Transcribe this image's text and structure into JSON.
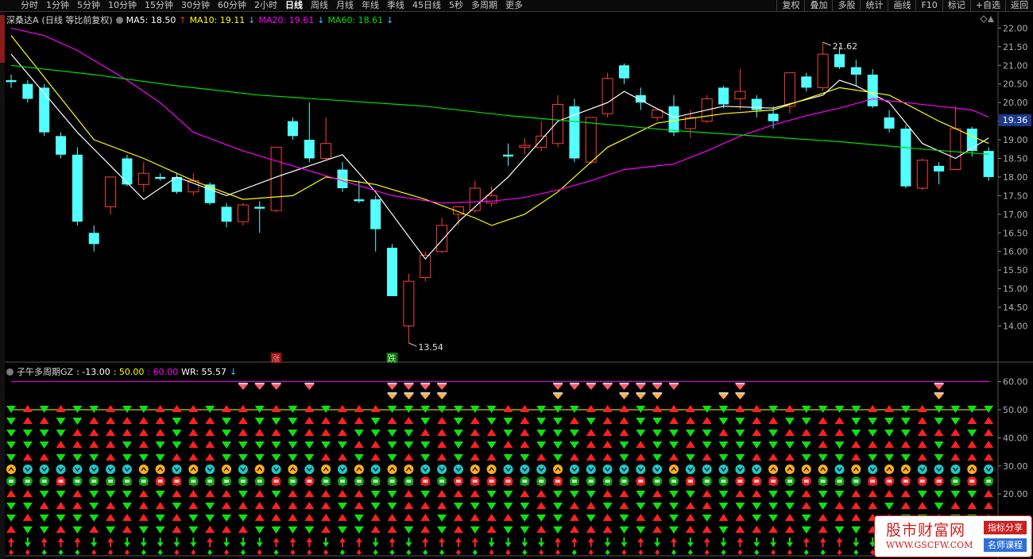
{
  "toolbar": {
    "tabs": [
      "分时",
      "1分钟",
      "5分钟",
      "10分钟",
      "15分钟",
      "30分钟",
      "60分钟",
      "2小时",
      "日线",
      "周线",
      "月线",
      "年线",
      "季线",
      "45日线",
      "5秒",
      "多周期",
      "更多"
    ],
    "active_tab": "日线",
    "right_buttons": [
      "复权",
      "叠加",
      "多股",
      "统计",
      "画线",
      "F10",
      "标记",
      "+自选",
      "返回"
    ]
  },
  "main_legend": {
    "name": "深桑达A",
    "mode": "(日线 等比前复权)",
    "ma5": "MA5: 18.50",
    "ma10": "MA10: 19.11",
    "ma20": "MA20: 19.61",
    "ma60": "MA60: 18.61",
    "colors": {
      "ma5": "#ffffff",
      "ma10": "#ffff00",
      "ma20": "#ff00ff",
      "ma60": "#00e000"
    }
  },
  "sub_legend": {
    "name": "子午多周期GZ",
    "v1": ": -13.00",
    "v2": ": 50.00",
    "v3": ": 60.00",
    "wr": "WR: 55.57",
    "colors": {
      "v1": "#ffffff",
      "v2": "#ffff00",
      "v3": "#ff00ff"
    }
  },
  "current_price": "19.36",
  "watermark": {
    "title": "股市财富网",
    "url": "WWW.GSCFW.COM",
    "tag1": "指标分享",
    "tag2": "名师课程"
  },
  "chart_data": {
    "type": "candlestick",
    "yaxis_main": {
      "ticks": [
        "22.00",
        "21.50",
        "21.00",
        "20.50",
        "20.00",
        "19.50",
        "19.00",
        "18.50",
        "18.00",
        "17.50",
        "17.00",
        "16.50",
        "16.00",
        "15.50",
        "15.00",
        "14.50",
        "14.00"
      ],
      "range": [
        13.2,
        22.2
      ]
    },
    "yaxis_sub": {
      "ticks": [
        "60.00",
        "50.00",
        "40.00",
        "30.00",
        "20.00",
        "10.00"
      ],
      "range": [
        -2,
        63
      ]
    },
    "annotations": {
      "high": "21.62",
      "low": "13.54",
      "up_marker": "涨",
      "down_marker": "跌"
    },
    "candles": [
      {
        "o": 20.6,
        "h": 20.75,
        "c": 20.55,
        "l": 20.4
      },
      {
        "o": 20.5,
        "h": 20.6,
        "c": 20.1,
        "l": 20.0
      },
      {
        "o": 20.4,
        "h": 20.5,
        "c": 19.2,
        "l": 19.1
      },
      {
        "o": 19.1,
        "h": 19.2,
        "c": 18.6,
        "l": 18.5
      },
      {
        "o": 18.6,
        "h": 18.8,
        "c": 16.8,
        "l": 16.7
      },
      {
        "o": 16.5,
        "h": 16.7,
        "c": 16.2,
        "l": 16.0
      },
      {
        "o": 17.2,
        "h": 18.0,
        "c": 18.0,
        "l": 17.0
      },
      {
        "o": 18.5,
        "h": 18.6,
        "c": 17.8,
        "l": 17.75
      },
      {
        "o": 17.8,
        "h": 18.4,
        "c": 18.1,
        "l": 17.6
      },
      {
        "o": 18.0,
        "h": 18.1,
        "c": 17.95,
        "l": 17.9
      },
      {
        "o": 18.0,
        "h": 18.1,
        "c": 17.6,
        "l": 17.55
      },
      {
        "o": 17.6,
        "h": 18.1,
        "c": 17.9,
        "l": 17.5
      },
      {
        "o": 17.8,
        "h": 17.85,
        "c": 17.3,
        "l": 17.25
      },
      {
        "o": 17.2,
        "h": 17.3,
        "c": 16.8,
        "l": 16.65
      },
      {
        "o": 16.8,
        "h": 17.3,
        "c": 17.25,
        "l": 16.7
      },
      {
        "o": 17.2,
        "h": 17.35,
        "c": 17.15,
        "l": 16.5
      },
      {
        "o": 17.1,
        "h": 17.2,
        "c": 18.8,
        "l": 17.05
      },
      {
        "o": 19.5,
        "h": 19.6,
        "c": 19.1,
        "l": 19.0
      },
      {
        "o": 19.0,
        "h": 20.0,
        "c": 18.5,
        "l": 18.4
      },
      {
        "o": 18.5,
        "h": 19.6,
        "c": 18.9,
        "l": 18.45
      },
      {
        "o": 18.2,
        "h": 18.4,
        "c": 17.7,
        "l": 17.6
      },
      {
        "o": 17.4,
        "h": 17.9,
        "c": 17.35,
        "l": 17.3
      },
      {
        "o": 17.4,
        "h": 17.5,
        "c": 16.6,
        "l": 16.0
      },
      {
        "o": 16.1,
        "h": 16.2,
        "c": 14.8,
        "l": 14.8
      },
      {
        "o": 14.0,
        "h": 15.4,
        "c": 15.2,
        "l": 13.54
      },
      {
        "o": 15.3,
        "h": 16.0,
        "c": 15.9,
        "l": 15.2
      },
      {
        "o": 16.0,
        "h": 16.9,
        "c": 16.7,
        "l": 15.95
      },
      {
        "o": 17.0,
        "h": 17.2,
        "c": 17.2,
        "l": 16.7
      },
      {
        "o": 17.1,
        "h": 17.9,
        "c": 17.7,
        "l": 17.05
      },
      {
        "o": 17.3,
        "h": 17.75,
        "c": 17.5,
        "l": 17.2
      },
      {
        "o": 18.6,
        "h": 18.9,
        "c": 18.55,
        "l": 18.3
      },
      {
        "o": 18.8,
        "h": 19.05,
        "c": 18.85,
        "l": 18.6
      },
      {
        "o": 18.8,
        "h": 19.5,
        "c": 19.1,
        "l": 18.7
      },
      {
        "o": 18.9,
        "h": 20.2,
        "c": 19.95,
        "l": 18.8
      },
      {
        "o": 19.9,
        "h": 20.1,
        "c": 18.5,
        "l": 18.4
      },
      {
        "o": 18.4,
        "h": 19.6,
        "c": 19.6,
        "l": 18.35
      },
      {
        "o": 19.7,
        "h": 20.8,
        "c": 20.65,
        "l": 19.6
      },
      {
        "o": 21.0,
        "h": 21.05,
        "c": 20.65,
        "l": 20.5
      },
      {
        "o": 20.2,
        "h": 20.4,
        "c": 20.0,
        "l": 19.8
      },
      {
        "o": 19.6,
        "h": 19.8,
        "c": 19.8,
        "l": 19.5
      },
      {
        "o": 19.9,
        "h": 20.2,
        "c": 19.2,
        "l": 19.1
      },
      {
        "o": 19.3,
        "h": 19.8,
        "c": 19.6,
        "l": 19.05
      },
      {
        "o": 19.5,
        "h": 20.2,
        "c": 20.1,
        "l": 19.45
      },
      {
        "o": 20.4,
        "h": 20.45,
        "c": 19.95,
        "l": 19.85
      },
      {
        "o": 20.1,
        "h": 20.9,
        "c": 20.3,
        "l": 19.8
      },
      {
        "o": 20.1,
        "h": 20.2,
        "c": 19.8,
        "l": 19.6
      },
      {
        "o": 19.7,
        "h": 19.9,
        "c": 19.5,
        "l": 19.3
      },
      {
        "o": 19.9,
        "h": 20.7,
        "c": 20.8,
        "l": 19.7
      },
      {
        "o": 20.7,
        "h": 20.8,
        "c": 20.4,
        "l": 20.3
      },
      {
        "o": 20.4,
        "h": 21.62,
        "c": 21.3,
        "l": 20.3
      },
      {
        "o": 21.3,
        "h": 21.5,
        "c": 20.95,
        "l": 20.9
      },
      {
        "o": 20.95,
        "h": 21.15,
        "c": 20.75,
        "l": 20.45
      },
      {
        "o": 20.75,
        "h": 20.9,
        "c": 19.9,
        "l": 19.85
      },
      {
        "o": 19.6,
        "h": 19.8,
        "c": 19.3,
        "l": 19.2
      },
      {
        "o": 19.3,
        "h": 19.4,
        "c": 17.75,
        "l": 17.7
      },
      {
        "o": 17.7,
        "h": 18.5,
        "c": 18.45,
        "l": 17.65
      },
      {
        "o": 18.3,
        "h": 18.4,
        "c": 18.15,
        "l": 17.8
      },
      {
        "o": 18.2,
        "h": 19.9,
        "c": 19.3,
        "l": 18.2
      },
      {
        "o": 19.3,
        "h": 19.35,
        "c": 18.7,
        "l": 18.55
      },
      {
        "o": 18.7,
        "h": 18.8,
        "c": 18.0,
        "l": 17.9
      }
    ],
    "ma_lines": [
      {
        "name": "MA5",
        "color": "#ffffff",
        "points": [
          [
            0,
            21.3
          ],
          [
            4,
            19.2
          ],
          [
            8,
            17.4
          ],
          [
            10,
            18.0
          ],
          [
            13,
            17.5
          ],
          [
            16,
            18.0
          ],
          [
            20,
            18.6
          ],
          [
            22,
            17.6
          ],
          [
            25,
            15.8
          ],
          [
            27,
            16.8
          ],
          [
            30,
            18.0
          ],
          [
            33,
            19.5
          ],
          [
            36,
            20.0
          ],
          [
            37,
            20.3
          ],
          [
            40,
            19.6
          ],
          [
            43,
            19.9
          ],
          [
            46,
            19.85
          ],
          [
            49,
            20.2
          ],
          [
            50,
            20.6
          ],
          [
            51,
            20.45
          ],
          [
            53,
            20.0
          ],
          [
            55,
            18.9
          ],
          [
            57,
            18.5
          ],
          [
            59,
            19.05
          ]
        ]
      },
      {
        "name": "MA10",
        "color": "#ffff00",
        "points": [
          [
            0,
            21.8
          ],
          [
            5,
            19.0
          ],
          [
            8,
            18.5
          ],
          [
            11,
            17.9
          ],
          [
            14,
            17.4
          ],
          [
            17,
            17.5
          ],
          [
            19,
            18.0
          ],
          [
            22,
            17.8
          ],
          [
            25,
            17.4
          ],
          [
            28,
            16.9
          ],
          [
            29,
            16.7
          ],
          [
            31,
            17.0
          ],
          [
            33,
            17.6
          ],
          [
            36,
            18.8
          ],
          [
            39,
            19.45
          ],
          [
            43,
            19.7
          ],
          [
            46,
            19.8
          ],
          [
            50,
            20.4
          ],
          [
            53,
            20.2
          ],
          [
            56,
            19.5
          ],
          [
            58,
            19.1
          ],
          [
            59,
            18.9
          ]
        ]
      },
      {
        "name": "MA20",
        "color": "#ff00ff",
        "points": [
          [
            0,
            22.0
          ],
          [
            2,
            21.8
          ],
          [
            4,
            21.4
          ],
          [
            7,
            20.6
          ],
          [
            9,
            20.0
          ],
          [
            11,
            19.2
          ],
          [
            14,
            18.7
          ],
          [
            17,
            18.3
          ],
          [
            20,
            17.9
          ],
          [
            23,
            17.5
          ],
          [
            26,
            17.3
          ],
          [
            29,
            17.35
          ],
          [
            31,
            17.45
          ],
          [
            33,
            17.65
          ],
          [
            35,
            17.9
          ],
          [
            37,
            18.2
          ],
          [
            40,
            18.35
          ],
          [
            42,
            18.7
          ],
          [
            44,
            19.1
          ],
          [
            46,
            19.4
          ],
          [
            48,
            19.65
          ],
          [
            50,
            19.85
          ],
          [
            52,
            20.1
          ],
          [
            54,
            20.0
          ],
          [
            56,
            19.9
          ],
          [
            58,
            19.8
          ],
          [
            59,
            19.61
          ]
        ]
      },
      {
        "name": "MA60",
        "color": "#00e000",
        "points": [
          [
            0,
            21.0
          ],
          [
            5,
            20.75
          ],
          [
            10,
            20.45
          ],
          [
            15,
            20.2
          ],
          [
            20,
            20.05
          ],
          [
            25,
            19.9
          ],
          [
            30,
            19.65
          ],
          [
            35,
            19.45
          ],
          [
            40,
            19.25
          ],
          [
            45,
            19.1
          ],
          [
            50,
            18.95
          ],
          [
            55,
            18.75
          ],
          [
            59,
            18.61
          ]
        ]
      }
    ],
    "indicator_lines": [
      {
        "name": "v3",
        "value": 60.0,
        "color": "#ff00ff"
      },
      {
        "name": "v2",
        "value": 50.0,
        "color": "#ffff00"
      }
    ],
    "signal_rows": {
      "diamonds_top": [
        7,
        8,
        9,
        11,
        16,
        17,
        18,
        19,
        26,
        27,
        28,
        29,
        30,
        31,
        32,
        33,
        37,
        49
      ],
      "diamonds_low": [
        16,
        17,
        18,
        19,
        26,
        30,
        31,
        32,
        36,
        37,
        49
      ],
      "row_pattern_seed": "mixed"
    }
  }
}
